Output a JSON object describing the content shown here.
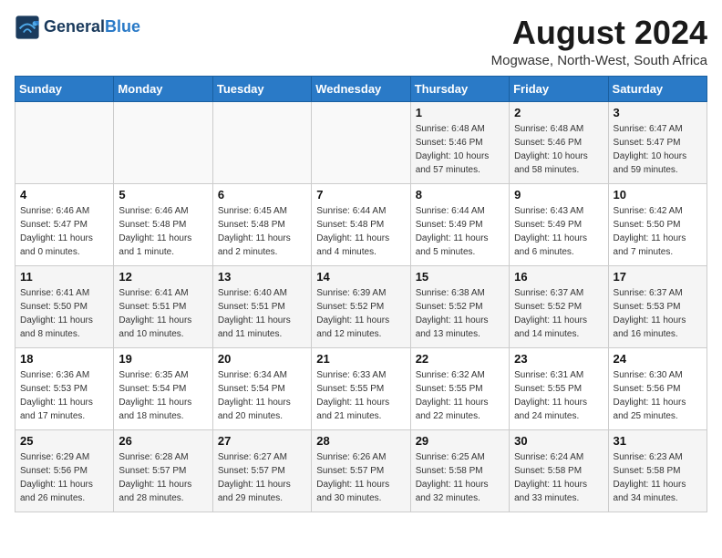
{
  "logo": {
    "line1": "General",
    "line2": "Blue"
  },
  "title": "August 2024",
  "location": "Mogwase, North-West, South Africa",
  "days_of_week": [
    "Sunday",
    "Monday",
    "Tuesday",
    "Wednesday",
    "Thursday",
    "Friday",
    "Saturday"
  ],
  "weeks": [
    [
      {
        "date": "",
        "sunrise": "",
        "sunset": "",
        "daylight": ""
      },
      {
        "date": "",
        "sunrise": "",
        "sunset": "",
        "daylight": ""
      },
      {
        "date": "",
        "sunrise": "",
        "sunset": "",
        "daylight": ""
      },
      {
        "date": "",
        "sunrise": "",
        "sunset": "",
        "daylight": ""
      },
      {
        "date": "1",
        "sunrise": "Sunrise: 6:48 AM",
        "sunset": "Sunset: 5:46 PM",
        "daylight": "Daylight: 10 hours and 57 minutes."
      },
      {
        "date": "2",
        "sunrise": "Sunrise: 6:48 AM",
        "sunset": "Sunset: 5:46 PM",
        "daylight": "Daylight: 10 hours and 58 minutes."
      },
      {
        "date": "3",
        "sunrise": "Sunrise: 6:47 AM",
        "sunset": "Sunset: 5:47 PM",
        "daylight": "Daylight: 10 hours and 59 minutes."
      }
    ],
    [
      {
        "date": "4",
        "sunrise": "Sunrise: 6:46 AM",
        "sunset": "Sunset: 5:47 PM",
        "daylight": "Daylight: 11 hours and 0 minutes."
      },
      {
        "date": "5",
        "sunrise": "Sunrise: 6:46 AM",
        "sunset": "Sunset: 5:48 PM",
        "daylight": "Daylight: 11 hours and 1 minute."
      },
      {
        "date": "6",
        "sunrise": "Sunrise: 6:45 AM",
        "sunset": "Sunset: 5:48 PM",
        "daylight": "Daylight: 11 hours and 2 minutes."
      },
      {
        "date": "7",
        "sunrise": "Sunrise: 6:44 AM",
        "sunset": "Sunset: 5:48 PM",
        "daylight": "Daylight: 11 hours and 4 minutes."
      },
      {
        "date": "8",
        "sunrise": "Sunrise: 6:44 AM",
        "sunset": "Sunset: 5:49 PM",
        "daylight": "Daylight: 11 hours and 5 minutes."
      },
      {
        "date": "9",
        "sunrise": "Sunrise: 6:43 AM",
        "sunset": "Sunset: 5:49 PM",
        "daylight": "Daylight: 11 hours and 6 minutes."
      },
      {
        "date": "10",
        "sunrise": "Sunrise: 6:42 AM",
        "sunset": "Sunset: 5:50 PM",
        "daylight": "Daylight: 11 hours and 7 minutes."
      }
    ],
    [
      {
        "date": "11",
        "sunrise": "Sunrise: 6:41 AM",
        "sunset": "Sunset: 5:50 PM",
        "daylight": "Daylight: 11 hours and 8 minutes."
      },
      {
        "date": "12",
        "sunrise": "Sunrise: 6:41 AM",
        "sunset": "Sunset: 5:51 PM",
        "daylight": "Daylight: 11 hours and 10 minutes."
      },
      {
        "date": "13",
        "sunrise": "Sunrise: 6:40 AM",
        "sunset": "Sunset: 5:51 PM",
        "daylight": "Daylight: 11 hours and 11 minutes."
      },
      {
        "date": "14",
        "sunrise": "Sunrise: 6:39 AM",
        "sunset": "Sunset: 5:52 PM",
        "daylight": "Daylight: 11 hours and 12 minutes."
      },
      {
        "date": "15",
        "sunrise": "Sunrise: 6:38 AM",
        "sunset": "Sunset: 5:52 PM",
        "daylight": "Daylight: 11 hours and 13 minutes."
      },
      {
        "date": "16",
        "sunrise": "Sunrise: 6:37 AM",
        "sunset": "Sunset: 5:52 PM",
        "daylight": "Daylight: 11 hours and 14 minutes."
      },
      {
        "date": "17",
        "sunrise": "Sunrise: 6:37 AM",
        "sunset": "Sunset: 5:53 PM",
        "daylight": "Daylight: 11 hours and 16 minutes."
      }
    ],
    [
      {
        "date": "18",
        "sunrise": "Sunrise: 6:36 AM",
        "sunset": "Sunset: 5:53 PM",
        "daylight": "Daylight: 11 hours and 17 minutes."
      },
      {
        "date": "19",
        "sunrise": "Sunrise: 6:35 AM",
        "sunset": "Sunset: 5:54 PM",
        "daylight": "Daylight: 11 hours and 18 minutes."
      },
      {
        "date": "20",
        "sunrise": "Sunrise: 6:34 AM",
        "sunset": "Sunset: 5:54 PM",
        "daylight": "Daylight: 11 hours and 20 minutes."
      },
      {
        "date": "21",
        "sunrise": "Sunrise: 6:33 AM",
        "sunset": "Sunset: 5:55 PM",
        "daylight": "Daylight: 11 hours and 21 minutes."
      },
      {
        "date": "22",
        "sunrise": "Sunrise: 6:32 AM",
        "sunset": "Sunset: 5:55 PM",
        "daylight": "Daylight: 11 hours and 22 minutes."
      },
      {
        "date": "23",
        "sunrise": "Sunrise: 6:31 AM",
        "sunset": "Sunset: 5:55 PM",
        "daylight": "Daylight: 11 hours and 24 minutes."
      },
      {
        "date": "24",
        "sunrise": "Sunrise: 6:30 AM",
        "sunset": "Sunset: 5:56 PM",
        "daylight": "Daylight: 11 hours and 25 minutes."
      }
    ],
    [
      {
        "date": "25",
        "sunrise": "Sunrise: 6:29 AM",
        "sunset": "Sunset: 5:56 PM",
        "daylight": "Daylight: 11 hours and 26 minutes."
      },
      {
        "date": "26",
        "sunrise": "Sunrise: 6:28 AM",
        "sunset": "Sunset: 5:57 PM",
        "daylight": "Daylight: 11 hours and 28 minutes."
      },
      {
        "date": "27",
        "sunrise": "Sunrise: 6:27 AM",
        "sunset": "Sunset: 5:57 PM",
        "daylight": "Daylight: 11 hours and 29 minutes."
      },
      {
        "date": "28",
        "sunrise": "Sunrise: 6:26 AM",
        "sunset": "Sunset: 5:57 PM",
        "daylight": "Daylight: 11 hours and 30 minutes."
      },
      {
        "date": "29",
        "sunrise": "Sunrise: 6:25 AM",
        "sunset": "Sunset: 5:58 PM",
        "daylight": "Daylight: 11 hours and 32 minutes."
      },
      {
        "date": "30",
        "sunrise": "Sunrise: 6:24 AM",
        "sunset": "Sunset: 5:58 PM",
        "daylight": "Daylight: 11 hours and 33 minutes."
      },
      {
        "date": "31",
        "sunrise": "Sunrise: 6:23 AM",
        "sunset": "Sunset: 5:58 PM",
        "daylight": "Daylight: 11 hours and 34 minutes."
      }
    ]
  ]
}
